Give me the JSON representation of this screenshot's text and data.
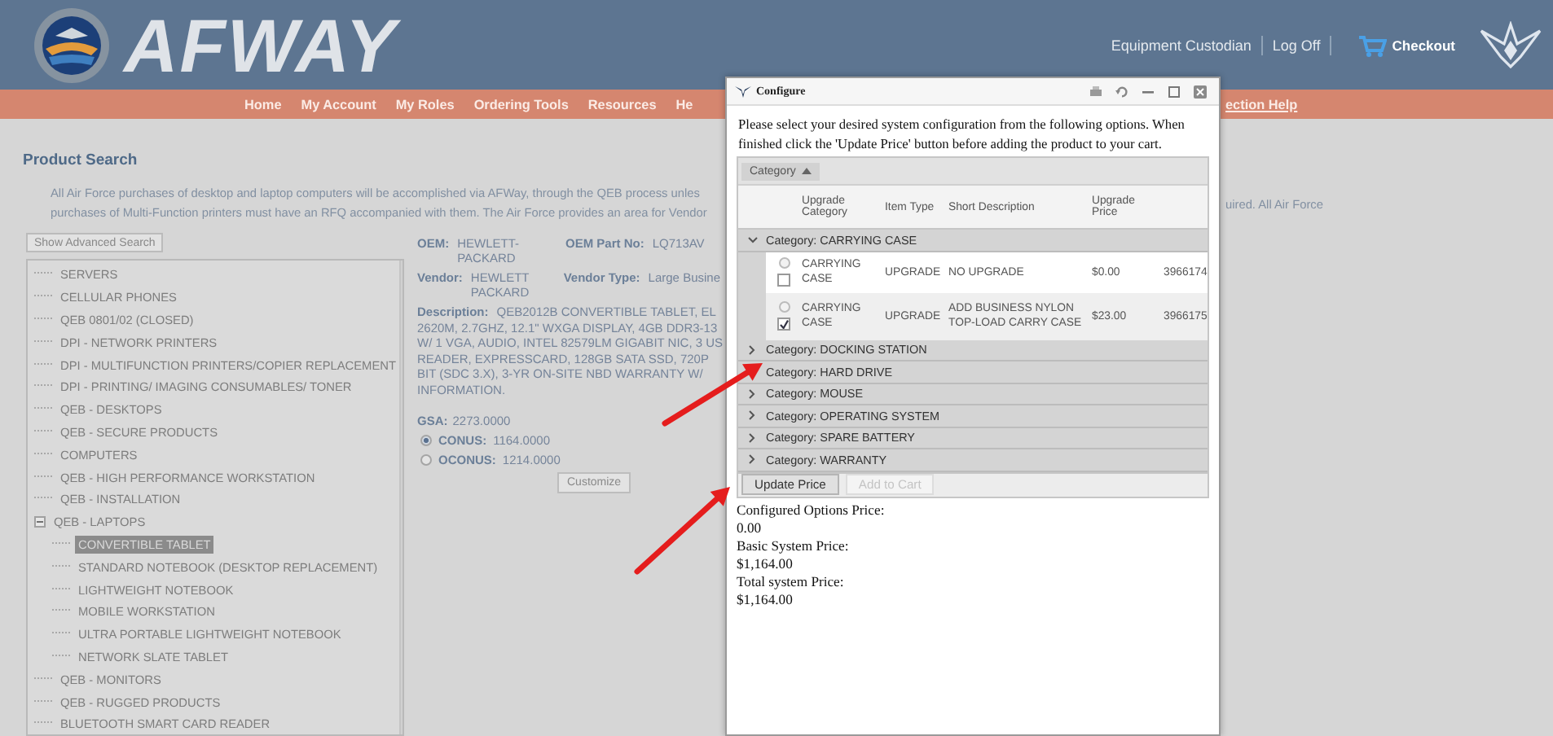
{
  "header": {
    "logo_text": "AFWAY",
    "links": [
      {
        "label": "Equipment Custodian"
      },
      {
        "label": "Log Off"
      }
    ],
    "checkout": "Checkout"
  },
  "nav": {
    "items": [
      {
        "label": "Home"
      },
      {
        "label": "My Account"
      },
      {
        "label": "My Roles"
      },
      {
        "label": "Ordering Tools"
      },
      {
        "label": "Resources"
      },
      {
        "label": "He"
      }
    ],
    "trailing_link": "ection Help"
  },
  "page": {
    "title": "Product Search",
    "intro_lines": [
      "All Air Force purchases of desktop and laptop computers will be accomplished via AFWay, through the QEB process unles",
      "purchases of Multi-Function printers must have an RFQ accompanied with them. The Air Force provides an area for Vendor"
    ],
    "intro_fragment": "uired. All Air Force",
    "advanced_search_button": "Show Advanced Search"
  },
  "tree": {
    "items": [
      {
        "label": "SERVERS",
        "selected": false
      },
      {
        "label": "CELLULAR PHONES",
        "selected": false
      },
      {
        "label": "QEB 0801/02 (CLOSED)",
        "selected": false
      },
      {
        "label": "DPI - NETWORK PRINTERS",
        "selected": false
      },
      {
        "label": "DPI - MULTIFUNCTION PRINTERS/COPIER REPLACEMENT",
        "selected": false
      },
      {
        "label": "DPI - PRINTING/ IMAGING CONSUMABLES/ TONER",
        "selected": false
      },
      {
        "label": "QEB - DESKTOPS",
        "selected": false
      },
      {
        "label": "QEB - SECURE PRODUCTS",
        "selected": false
      },
      {
        "label": "COMPUTERS",
        "selected": false
      },
      {
        "label": "QEB - HIGH PERFORMANCE WORKSTATION",
        "selected": false
      },
      {
        "label": "QEB - INSTALLATION",
        "selected": false
      },
      {
        "label": "QEB - LAPTOPS",
        "selected": false,
        "expanded": true,
        "children": [
          {
            "label": "CONVERTIBLE TABLET",
            "selected": true
          },
          {
            "label": "STANDARD NOTEBOOK (DESKTOP REPLACEMENT)",
            "selected": false
          },
          {
            "label": "LIGHTWEIGHT NOTEBOOK",
            "selected": false
          },
          {
            "label": "MOBILE WORKSTATION",
            "selected": false
          },
          {
            "label": "ULTRA PORTABLE LIGHTWEIGHT NOTEBOOK",
            "selected": false
          },
          {
            "label": "NETWORK SLATE TABLET",
            "selected": false
          }
        ]
      },
      {
        "label": "QEB - MONITORS",
        "selected": false
      },
      {
        "label": "QEB - RUGGED PRODUCTS",
        "selected": false
      },
      {
        "label": "BLUETOOTH SMART CARD READER",
        "selected": false
      }
    ]
  },
  "product": {
    "fields": [
      {
        "left": {
          "label": "OEM:",
          "value": "HEWLETT-PACKARD"
        },
        "right": {
          "label": "OEM Part No:",
          "value": "LQ713AV"
        }
      },
      {
        "left": {
          "label": "Vendor:",
          "value": "HEWLETT PACKARD"
        },
        "right": {
          "label": "Vendor Type:",
          "value": "Large Busine"
        }
      }
    ],
    "description": {
      "label": "Description:",
      "lines": [
        "QEB2012B CONVERTIBLE TABLET, EL",
        "2620M, 2.7GHZ, 12.1\" WXGA DISPLAY, 4GB DDR3-13",
        "W/ 1 VGA, AUDIO, INTEL 82579LM GIGABIT NIC, 3 US",
        "READER, EXPRESSCARD, 128GB SATA SSD, 720P",
        "BIT (SDC 3.X), 3-YR ON-SITE NBD WARRANTY W/",
        "INFORMATION."
      ]
    },
    "gsa": {
      "label": "GSA:",
      "value": "2273.0000"
    },
    "price_options": [
      {
        "label": "CONUS:",
        "value": "1164.0000",
        "selected": true
      },
      {
        "label": "OCONUS:",
        "value": "1214.0000",
        "selected": false
      }
    ],
    "customize_button": "Customize"
  },
  "dialog": {
    "title": "Configure",
    "instructions": "Please select your desired system configuration from the following options. When finished click the 'Update Price' button before adding the product to your cart.",
    "group_by": "Category",
    "columns": [
      {
        "label": "Upgrade Category"
      },
      {
        "label": "Item Type"
      },
      {
        "label": "Short Description"
      },
      {
        "label": "Upgrade Price"
      }
    ],
    "groups": [
      {
        "label": "Category: CARRYING CASE",
        "expanded": true,
        "rows": [
          {
            "selected": false,
            "checked": false,
            "cells": [
              "CARRYING CASE",
              "UPGRADE",
              "NO UPGRADE",
              "$0.00",
              "3966174"
            ]
          },
          {
            "selected": false,
            "checked": true,
            "cells": [
              "CARRYING CASE",
              "UPGRADE",
              "ADD BUSINESS NYLON TOP-LOAD CARRY CASE",
              "$23.00",
              "3966175"
            ]
          }
        ]
      },
      {
        "label": "Category: DOCKING STATION",
        "expanded": false
      },
      {
        "label": "Category: HARD DRIVE",
        "expanded": false
      },
      {
        "label": "Category: MOUSE",
        "expanded": false
      },
      {
        "label": "Category: OPERATING SYSTEM",
        "expanded": false
      },
      {
        "label": "Category: SPARE BATTERY",
        "expanded": false
      },
      {
        "label": "Category: WARRANTY",
        "expanded": false
      }
    ],
    "buttons": [
      {
        "label": "Update Price",
        "disabled": false
      },
      {
        "label": "Add to Cart",
        "disabled": true
      }
    ],
    "summary": [
      {
        "label": "Configured Options Price:",
        "value": "0.00"
      },
      {
        "label": "Basic System Price:",
        "value": "$1,164.00"
      },
      {
        "label": "Total system Price:",
        "value": "$1,164.00"
      }
    ]
  }
}
